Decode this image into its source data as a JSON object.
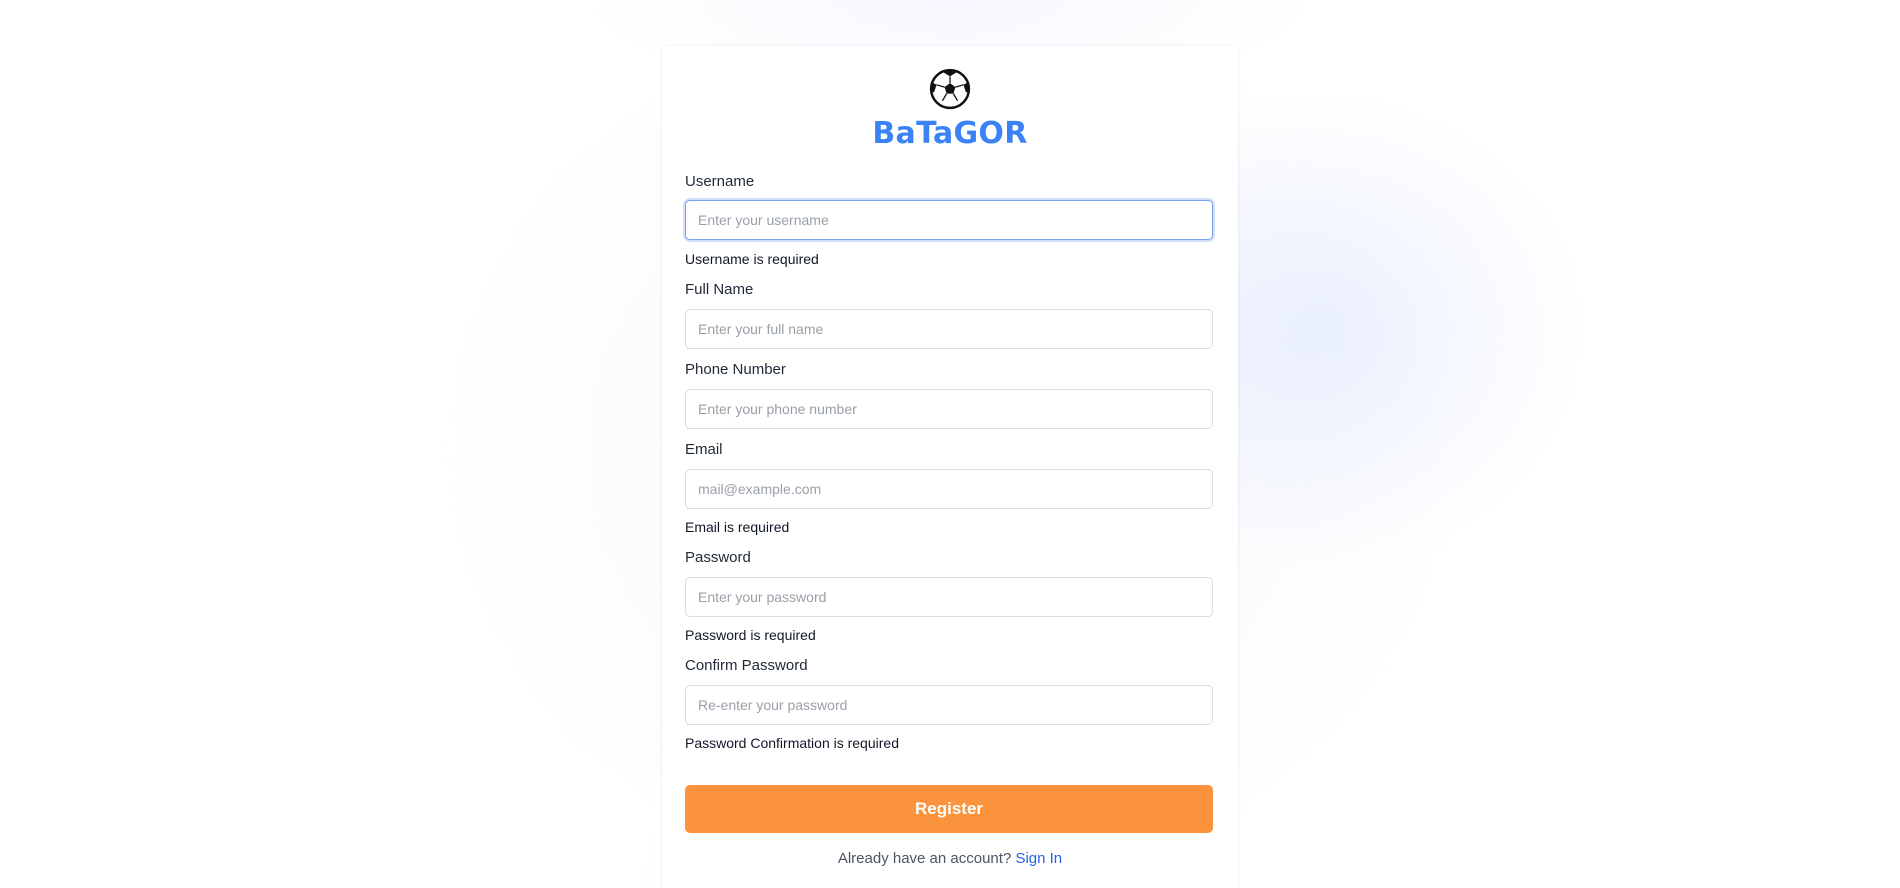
{
  "brand": {
    "name": "BaTaGOR",
    "logo_icon": "soccer-ball-icon",
    "accent_color": "#3b82f6"
  },
  "form": {
    "username": {
      "label": "Username",
      "placeholder": "Enter your username",
      "value": "",
      "error": "Username is required"
    },
    "full_name": {
      "label": "Full Name",
      "placeholder": "Enter your full name",
      "value": ""
    },
    "phone": {
      "label": "Phone Number",
      "placeholder": "Enter your phone number",
      "value": ""
    },
    "email": {
      "label": "Email",
      "placeholder": "mail@example.com",
      "value": "",
      "error": "Email is required"
    },
    "password": {
      "label": "Password",
      "placeholder": "Enter your password",
      "value": "",
      "error": "Password is required"
    },
    "confirm_password": {
      "label": "Confirm Password",
      "placeholder": "Re-enter your password",
      "value": "",
      "error": "Password Confirmation is required"
    },
    "submit_label": "Register",
    "submit_color": "#fb923c"
  },
  "footer": {
    "prompt": "Already have an account?",
    "link_label": "Sign In",
    "link_color": "#2563eb"
  }
}
